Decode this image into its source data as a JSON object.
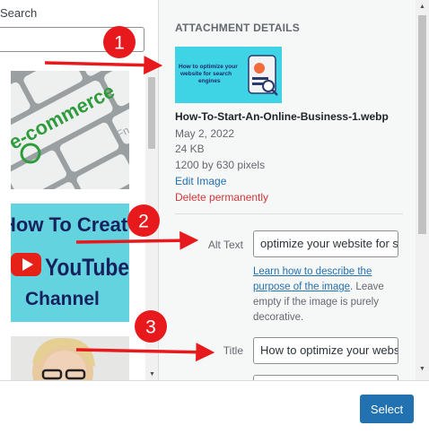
{
  "search": {
    "label": "Search"
  },
  "thumbnails": [
    {
      "name": "ecommerce-keyboard",
      "text": "e-commerce",
      "key_labels": [
        "Z",
        "Fn"
      ]
    },
    {
      "name": "youtube-channel",
      "lines": [
        "How To Creat",
        "YouTube",
        "Channel"
      ]
    },
    {
      "name": "woman-portrait"
    }
  ],
  "details": {
    "heading": "ATTACHMENT DETAILS",
    "preview_text": "How to optimize your website for search engines",
    "file_name": "How-To-Start-An-Online-Business-1.webp",
    "upload_date": "May 2, 2022",
    "file_size": "24 KB",
    "dimensions": "1200 by 630 pixels",
    "edit_link": "Edit Image",
    "delete_link": "Delete permanently",
    "alt_label": "Alt Text",
    "alt_value": "optimize your website for search engines",
    "alt_help_link": "Learn how to describe the purpose of the image",
    "alt_help_rest": ". Leave empty if the image is purely decorative.",
    "title_label": "Title",
    "title_value": "How to optimize your website"
  },
  "toolbar": {
    "select_label": "Select"
  },
  "annotations": {
    "badges": [
      "1",
      "2",
      "3"
    ]
  },
  "colors": {
    "accent": "#2271b1",
    "danger": "#d63638",
    "annotation": "#e8191d"
  }
}
